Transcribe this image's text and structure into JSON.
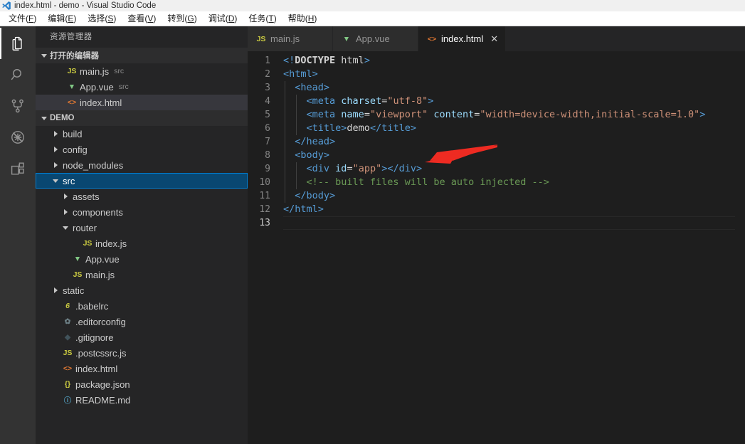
{
  "window": {
    "title": "index.html - demo - Visual Studio Code",
    "app_icon": "vscode-icon"
  },
  "menubar": {
    "items": [
      {
        "text": "文件",
        "mnemonic": "F"
      },
      {
        "text": "编辑",
        "mnemonic": "E"
      },
      {
        "text": "选择",
        "mnemonic": "S"
      },
      {
        "text": "查看",
        "mnemonic": "V"
      },
      {
        "text": "转到",
        "mnemonic": "G"
      },
      {
        "text": "调试",
        "mnemonic": "D"
      },
      {
        "text": "任务",
        "mnemonic": "T"
      },
      {
        "text": "帮助",
        "mnemonic": "H"
      }
    ]
  },
  "activitybar": {
    "items": [
      {
        "name": "explorer",
        "icon": "files-icon",
        "active": true
      },
      {
        "name": "search",
        "icon": "search-icon",
        "active": false
      },
      {
        "name": "source-control",
        "icon": "source-control-icon",
        "active": false
      },
      {
        "name": "debug",
        "icon": "debug-icon",
        "active": false
      },
      {
        "name": "extensions",
        "icon": "extensions-icon",
        "active": false
      }
    ]
  },
  "sidebar": {
    "title": "资源管理器",
    "open_editors": {
      "label": "打开的编辑器",
      "expanded": true,
      "items": [
        {
          "label": "main.js",
          "desc": "src",
          "icon": "js-icon",
          "selected": false
        },
        {
          "label": "App.vue",
          "desc": "src",
          "icon": "vue-icon",
          "selected": false
        },
        {
          "label": "index.html",
          "desc": "",
          "icon": "html-icon",
          "selected": true
        }
      ]
    },
    "project": {
      "label": "DEMO",
      "expanded": true,
      "items": [
        {
          "label": "build",
          "type": "folder",
          "indent": 1,
          "expanded": false,
          "icon": "folder-icon",
          "selected": false
        },
        {
          "label": "config",
          "type": "folder",
          "indent": 1,
          "expanded": false,
          "icon": "folder-icon",
          "selected": false
        },
        {
          "label": "node_modules",
          "type": "folder",
          "indent": 1,
          "expanded": false,
          "icon": "folder-icon",
          "selected": false
        },
        {
          "label": "src",
          "type": "folder",
          "indent": 1,
          "expanded": true,
          "icon": "folder-icon",
          "selected": true
        },
        {
          "label": "assets",
          "type": "folder",
          "indent": 2,
          "expanded": false,
          "icon": "folder-icon",
          "selected": false
        },
        {
          "label": "components",
          "type": "folder",
          "indent": 2,
          "expanded": false,
          "icon": "folder-icon",
          "selected": false
        },
        {
          "label": "router",
          "type": "folder",
          "indent": 2,
          "expanded": true,
          "icon": "folder-icon",
          "selected": false
        },
        {
          "label": "index.js",
          "type": "file",
          "indent": 3,
          "icon": "js-icon",
          "selected": false
        },
        {
          "label": "App.vue",
          "type": "file",
          "indent": 2,
          "icon": "vue-icon",
          "selected": false
        },
        {
          "label": "main.js",
          "type": "file",
          "indent": 2,
          "icon": "js-icon",
          "selected": false
        },
        {
          "label": "static",
          "type": "folder",
          "indent": 1,
          "expanded": false,
          "icon": "folder-icon",
          "selected": false
        },
        {
          "label": ".babelrc",
          "type": "file",
          "indent": 1,
          "icon": "babel-icon",
          "selected": false
        },
        {
          "label": ".editorconfig",
          "type": "file",
          "indent": 1,
          "icon": "gear-icon",
          "selected": false
        },
        {
          "label": ".gitignore",
          "type": "file",
          "indent": 1,
          "icon": "git-icon",
          "selected": false
        },
        {
          "label": ".postcssrc.js",
          "type": "file",
          "indent": 1,
          "icon": "js-icon",
          "selected": false
        },
        {
          "label": "index.html",
          "type": "file",
          "indent": 1,
          "icon": "html-icon",
          "selected": false
        },
        {
          "label": "package.json",
          "type": "file",
          "indent": 1,
          "icon": "json-icon",
          "selected": false
        },
        {
          "label": "README.md",
          "type": "file",
          "indent": 1,
          "icon": "markdown-icon",
          "selected": false
        }
      ]
    }
  },
  "editor": {
    "tabs": [
      {
        "label": "main.js",
        "icon": "js-icon",
        "active": false,
        "closable": false
      },
      {
        "label": "App.vue",
        "icon": "vue-icon",
        "active": false,
        "closable": false
      },
      {
        "label": "index.html",
        "icon": "html-icon",
        "active": true,
        "closable": true,
        "close_label": "✕"
      }
    ],
    "current_line": 13,
    "lines": [
      {
        "n": 1,
        "indent": 0,
        "tokens": [
          {
            "t": "doct",
            "v": "<!"
          },
          {
            "t": "doctname",
            "v": "DOCTYPE"
          },
          {
            "t": "txt",
            "v": " html"
          },
          {
            "t": "doct",
            "v": ">"
          }
        ]
      },
      {
        "n": 2,
        "indent": 0,
        "tokens": [
          {
            "t": "tag",
            "v": "<html>"
          }
        ]
      },
      {
        "n": 3,
        "indent": 1,
        "tokens": [
          {
            "t": "txt",
            "v": "  "
          },
          {
            "t": "tag",
            "v": "<head>"
          }
        ]
      },
      {
        "n": 4,
        "indent": 2,
        "tokens": [
          {
            "t": "txt",
            "v": "    "
          },
          {
            "t": "tag",
            "v": "<meta"
          },
          {
            "t": "txt",
            "v": " "
          },
          {
            "t": "attr",
            "v": "charset"
          },
          {
            "t": "eq",
            "v": "="
          },
          {
            "t": "str",
            "v": "\"utf-8\""
          },
          {
            "t": "tag",
            "v": ">"
          }
        ]
      },
      {
        "n": 5,
        "indent": 2,
        "tokens": [
          {
            "t": "txt",
            "v": "    "
          },
          {
            "t": "tag",
            "v": "<meta"
          },
          {
            "t": "txt",
            "v": " "
          },
          {
            "t": "attr",
            "v": "name"
          },
          {
            "t": "eq",
            "v": "="
          },
          {
            "t": "str",
            "v": "\"viewport\""
          },
          {
            "t": "txt",
            "v": " "
          },
          {
            "t": "attr",
            "v": "content"
          },
          {
            "t": "eq",
            "v": "="
          },
          {
            "t": "str",
            "v": "\"width=device-width,initial-scale=1.0\""
          },
          {
            "t": "tag",
            "v": ">"
          }
        ]
      },
      {
        "n": 6,
        "indent": 2,
        "tokens": [
          {
            "t": "txt",
            "v": "    "
          },
          {
            "t": "tag",
            "v": "<title>"
          },
          {
            "t": "txt",
            "v": "demo"
          },
          {
            "t": "tag",
            "v": "</title>"
          }
        ]
      },
      {
        "n": 7,
        "indent": 1,
        "tokens": [
          {
            "t": "txt",
            "v": "  "
          },
          {
            "t": "tag",
            "v": "</head>"
          }
        ]
      },
      {
        "n": 8,
        "indent": 1,
        "tokens": [
          {
            "t": "txt",
            "v": "  "
          },
          {
            "t": "tag",
            "v": "<body>"
          }
        ]
      },
      {
        "n": 9,
        "indent": 2,
        "tokens": [
          {
            "t": "txt",
            "v": "    "
          },
          {
            "t": "tag",
            "v": "<div"
          },
          {
            "t": "txt",
            "v": " "
          },
          {
            "t": "attr",
            "v": "id"
          },
          {
            "t": "eq",
            "v": "="
          },
          {
            "t": "str",
            "v": "\"app\""
          },
          {
            "t": "tag",
            "v": ">"
          },
          {
            "t": "tag",
            "v": "</div>"
          }
        ]
      },
      {
        "n": 10,
        "indent": 2,
        "tokens": [
          {
            "t": "txt",
            "v": "    "
          },
          {
            "t": "cmt",
            "v": "<!-- built files will be auto injected -->"
          }
        ]
      },
      {
        "n": 11,
        "indent": 1,
        "tokens": [
          {
            "t": "txt",
            "v": "  "
          },
          {
            "t": "tag",
            "v": "</body>"
          }
        ]
      },
      {
        "n": 12,
        "indent": 0,
        "tokens": [
          {
            "t": "tag",
            "v": "</html>"
          }
        ]
      },
      {
        "n": 13,
        "indent": 0,
        "tokens": []
      }
    ]
  },
  "annotation": {
    "type": "arrow",
    "color": "#ee2b22",
    "points_to": "line 9 <div id=\"app\"></div>"
  },
  "colors": {
    "editor_bg": "#1e1e1e",
    "sidebar_bg": "#252526",
    "activitybar_bg": "#333333",
    "selection_blue": "#094771",
    "selection_border": "#007fd4",
    "tab_active_bg": "#1e1e1e",
    "tab_inactive_bg": "#2d2d2d",
    "accent_red": "#ee2b22"
  }
}
